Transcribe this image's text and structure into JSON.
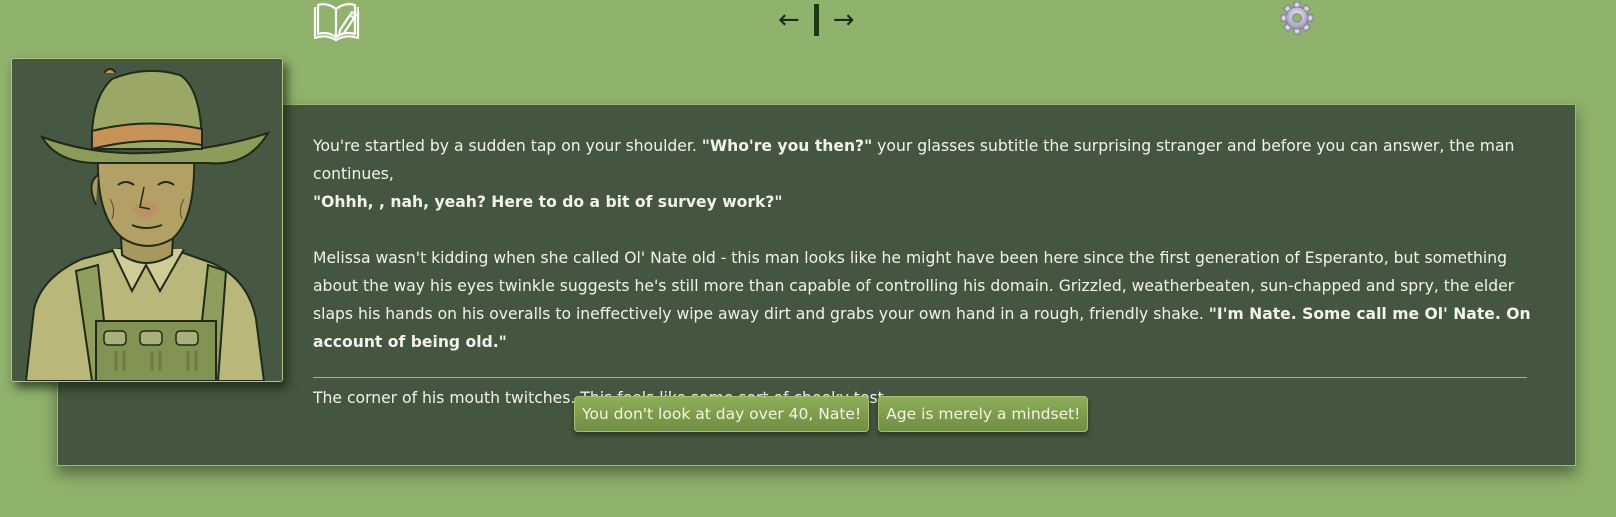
{
  "nav": {
    "back_arrow": "←",
    "forward_arrow": "→"
  },
  "icons": {
    "journal": "journal-icon",
    "settings": "gear-icon"
  },
  "colors": {
    "background": "#8fb26c",
    "panel": "#445640",
    "panel_border": "#a7b46d",
    "choice_button": "#7c9c4b",
    "text": "#f4f2ec"
  },
  "story": {
    "p1": {
      "t1": "You're startled by a sudden tap on your shoulder. ",
      "b1": "\"Who're you then?\"",
      "t2": " your glasses subtitle the surprising stranger and before you can answer, the man continues, ",
      "b2": "\"Ohhh, , nah, yeah? Here to do a bit of survey work?\""
    },
    "p2": {
      "t1": "Melissa wasn't kidding when she called Ol' Nate old - this man looks like he might have been here since the first generation of Esperanto, but something about the way his eyes twinkle suggests he's still more than capable of controlling his domain. Grizzled, weatherbeaten, sun-chapped and spry, the elder slaps his hands on his overalls to ineffectively wipe away dirt and grabs your own hand in a rough, friendly shake. ",
      "b1": "\"I'm Nate. Some call me Ol' Nate. On account of being old.\""
    },
    "p3": "The corner of his mouth twitches. This feels like some sort of cheeky test..."
  },
  "choices": [
    {
      "label": "You don't look at day over 40, Nate!"
    },
    {
      "label": "Age is merely a mindset!"
    }
  ]
}
